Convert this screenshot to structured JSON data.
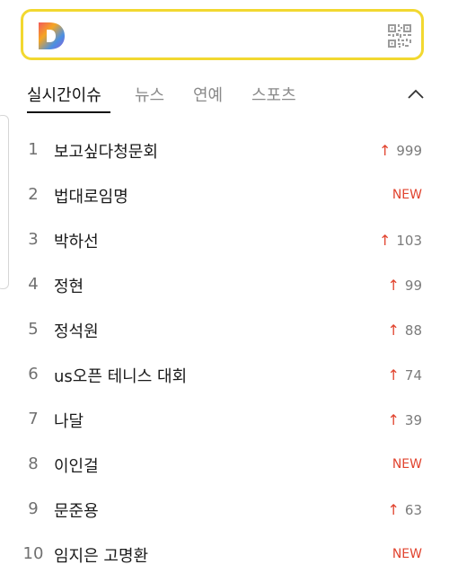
{
  "search": {
    "logo_icon": "daum-logo-icon",
    "qr_icon": "qr-code-icon",
    "border_color": "#f2d830"
  },
  "tabs": [
    {
      "label": "실시간이슈",
      "active": true
    },
    {
      "label": "뉴스",
      "active": false
    },
    {
      "label": "연예",
      "active": false
    },
    {
      "label": "스포츠",
      "active": false
    }
  ],
  "collapse_icon": "chevron-up-icon",
  "colors": {
    "rising": "#e1442f",
    "text": "#1a1a1a",
    "muted": "#7b7b7b"
  },
  "trends": [
    {
      "rank": "1",
      "keyword": "보고싶다청문회",
      "change": "999",
      "type": "up"
    },
    {
      "rank": "2",
      "keyword": "법대로임명",
      "change": "NEW",
      "type": "new"
    },
    {
      "rank": "3",
      "keyword": "박하선",
      "change": "103",
      "type": "up"
    },
    {
      "rank": "4",
      "keyword": "정현",
      "change": "99",
      "type": "up"
    },
    {
      "rank": "5",
      "keyword": "정석원",
      "change": "88",
      "type": "up"
    },
    {
      "rank": "6",
      "keyword": "us오픈 테니스 대회",
      "change": "74",
      "type": "up"
    },
    {
      "rank": "7",
      "keyword": "나달",
      "change": "39",
      "type": "up"
    },
    {
      "rank": "8",
      "keyword": "이인걸",
      "change": "NEW",
      "type": "new"
    },
    {
      "rank": "9",
      "keyword": "문준용",
      "change": "63",
      "type": "up"
    },
    {
      "rank": "10",
      "keyword": "임지은 고명환",
      "change": "NEW",
      "type": "new"
    }
  ]
}
